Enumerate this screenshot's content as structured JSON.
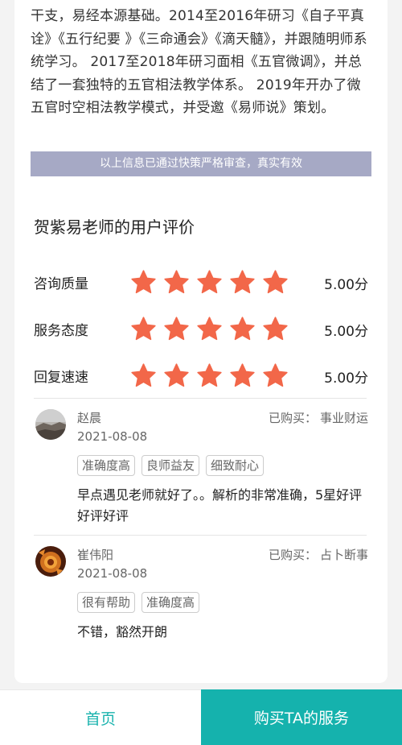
{
  "profile": {
    "bio": "干支，易经本源基础。2014至2016年研习《自子平真诠》《五行纪要 》《三命通会》《滴天髓》，并跟随明师系统学习。 2017至2018年研习面相《五官微调》，并总结了一套独特的五官相法教学体系。 2019年开办了微五官时空相法教学模式，并受邀《易师说》策划。",
    "verify_notice": "以上信息已通过快策严格审查，真实有效"
  },
  "reviews_section": {
    "title": "贺紫易老师的用户评价",
    "star_color": "#f26749",
    "ratings": [
      {
        "label": "咨询质量",
        "stars": 5,
        "score": "5.00分"
      },
      {
        "label": "服务态度",
        "stars": 5,
        "score": "5.00分"
      },
      {
        "label": "回复速速",
        "stars": 5,
        "score": "5.00分"
      }
    ],
    "bought_prefix": "已购买：",
    "reviews": [
      {
        "name": "赵晨",
        "date": "2021-08-08",
        "service": "事业财运",
        "tags": [
          "准确度高",
          "良师益友",
          "细致耐心"
        ],
        "text": "早点遇见老师就好了。。解析的非常准确，5星好评好评好评"
      },
      {
        "name": "崔伟阳",
        "date": "2021-08-08",
        "service": "占卜断事",
        "tags": [
          "很有帮助",
          "准确度高"
        ],
        "text": "不错，豁然开朗"
      }
    ]
  },
  "bottom_bar": {
    "home_label": "首页",
    "buy_label": "购买TA的服务",
    "accent": "#15b2ad"
  }
}
